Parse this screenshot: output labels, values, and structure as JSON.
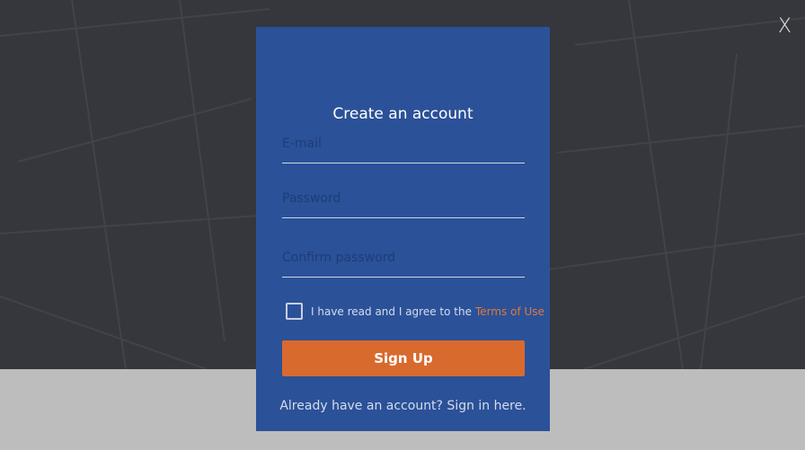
{
  "close": {
    "label": "X"
  },
  "modal": {
    "title": "Create an account",
    "fields": {
      "email_placeholder": "E-mail",
      "password_placeholder": "Password",
      "confirm_placeholder": "Confirm password"
    },
    "agree": {
      "text": "I have read and I agree to the",
      "link": "Terms of Use"
    },
    "signup_label": "Sign Up",
    "signin_text": "Already have an account? Sign in here."
  },
  "colors": {
    "backdrop": "#35373c",
    "modal": "#2b5198",
    "accent": "#d96a2e",
    "link": "#e07a3b",
    "lower_band": "#bdbdbd"
  }
}
